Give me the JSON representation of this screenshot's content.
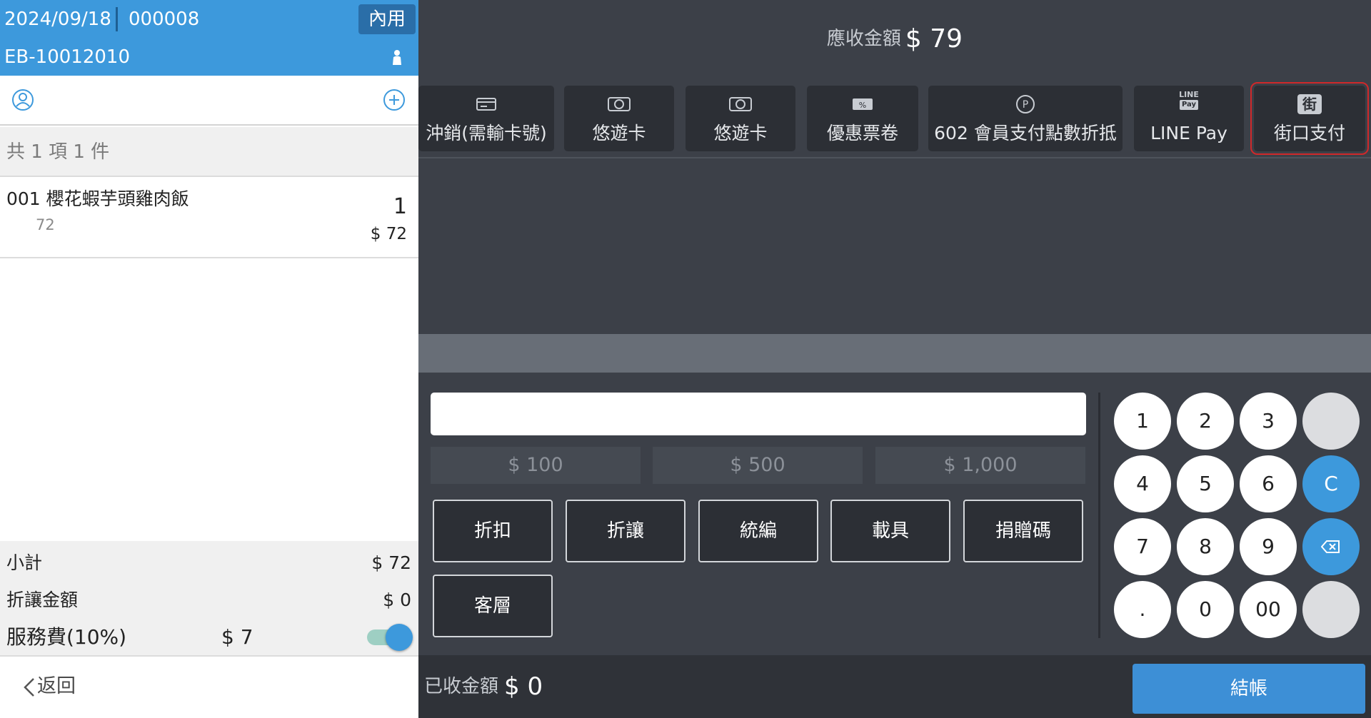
{
  "order_header": {
    "date": "2024/09/18",
    "order_no": "000008",
    "dine_type": "內用",
    "account": "EB-10012010"
  },
  "cart": {
    "summary": "共 1 項 1 件",
    "items": [
      {
        "code_name": "001 櫻花蝦芋頭雞肉飯",
        "base_price": "72",
        "qty": "1",
        "total": "$ 72"
      }
    ]
  },
  "totals": {
    "subtotal_label": "小計",
    "subtotal_value": "$ 72",
    "discount_label": "折讓金額",
    "discount_value": "$ 0",
    "service_label": "服務費(10%)",
    "service_value": "$ 7",
    "service_enabled": true
  },
  "nav": {
    "back_label": "返回"
  },
  "payment": {
    "due_label": "應收金額",
    "due_value": "$ 79",
    "methods": [
      {
        "label": "沖銷(需輸卡號)",
        "icon": "card-reversal-icon"
      },
      {
        "label": "悠遊卡",
        "icon": "easycard-icon"
      },
      {
        "label": "悠遊卡",
        "icon": "easycard-icon"
      },
      {
        "label": "優惠票卷",
        "icon": "coupon-icon"
      },
      {
        "label": "602 會員支付點數折抵",
        "icon": "points-icon"
      },
      {
        "label": "LINE Pay",
        "icon": "line-pay-icon",
        "icon_text_top": "LINE",
        "icon_text_bottom": "Pay"
      },
      {
        "label": "街口支付",
        "icon": "jko-pay-icon",
        "icon_text": "街",
        "highlighted": true
      }
    ],
    "amount_input_value": "",
    "quick_amounts": [
      "$ 100",
      "$ 500",
      "$ 1,000"
    ],
    "functions": [
      "折扣",
      "折讓",
      "統編",
      "載具",
      "捐贈碼",
      "客層"
    ],
    "keypad": {
      "keys": [
        "1",
        "2",
        "3",
        "",
        "4",
        "5",
        "6",
        "C",
        "7",
        "8",
        "9",
        "",
        ".",
        "0",
        "00",
        ""
      ]
    },
    "received_label": "已收金額",
    "received_value": "$ 0",
    "checkout_label": "結帳"
  },
  "colors": {
    "header_blue": "#3d99dc",
    "panel_dark": "#3c4048",
    "button_dark": "#2c2f35",
    "highlight_red": "#d0282a",
    "checkout_blue": "#3d8fd6"
  }
}
